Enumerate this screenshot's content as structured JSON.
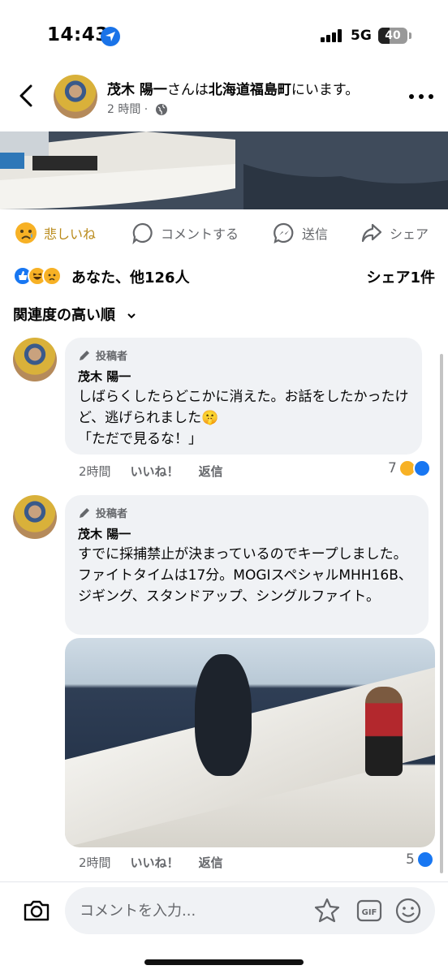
{
  "status_bar": {
    "time": "14:43",
    "network": "5G",
    "battery": "40",
    "battery_level": 0.4
  },
  "header": {
    "name": "茂木 陽一",
    "mid": "さんは",
    "place": "北海道福島町",
    "tail": "にいます。",
    "time": "2 時間 ·"
  },
  "actions": [
    {
      "label": "悲しいね",
      "icon": "sad-reaction-icon"
    },
    {
      "label": "コメントする",
      "icon": "comment-icon"
    },
    {
      "label": "送信",
      "icon": "messenger-icon"
    },
    {
      "label": "シェア",
      "icon": "share-icon"
    }
  ],
  "reactions": {
    "text": "あなた、他126人",
    "shares": "シェア1件"
  },
  "sort": {
    "label": "関連度の高い順"
  },
  "comments": [
    {
      "badge": "投稿者",
      "name": "茂木 陽一",
      "text": "しばらくしたらどこかに消えた。お話をしたかったけど、逃げられました🤫\n「ただで見るな！」",
      "time": "2時間",
      "like": "いいね！",
      "reply": "返信",
      "count": "7"
    },
    {
      "badge": "投稿者",
      "name": "茂木 陽一",
      "text": "すでに採捕禁止が決まっているのでキープしました。ファイトタイムは17分。MOGIスペシャルMHH16B、ジギング、スタンドアップ、シングルファイト。",
      "time": "2時間",
      "like": "いいね！",
      "reply": "返信",
      "count": "5"
    }
  ],
  "input": {
    "placeholder": "コメントを入力..."
  },
  "colors": {
    "facebook_blue": "#1877f2",
    "sad_yellow": "#b98a1a",
    "gray_text": "#65676b",
    "bubble": "#f0f2f5"
  }
}
